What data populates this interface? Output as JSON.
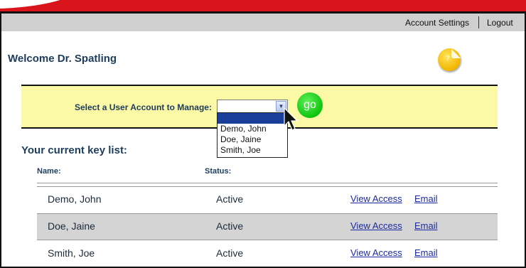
{
  "header": {
    "account_settings": "Account Settings",
    "logout": "Logout"
  },
  "welcome": "Welcome Dr. Spatling",
  "help_icon": "help-sticker-icon",
  "selector": {
    "label": "Select a User Account to Manage:",
    "selected_value": "",
    "go_label": "go",
    "options": [
      "Demo, John",
      "Doe, Jaine",
      "Smith, Joe"
    ]
  },
  "keylist": {
    "title": "Your current key list:",
    "columns": {
      "name": "Name:",
      "status": "Status:"
    },
    "rows": [
      {
        "name": "Demo, John",
        "status": "Active",
        "view": "View Access",
        "email": "Email"
      },
      {
        "name": "Doe, Jaine",
        "status": "Active",
        "view": "View Access",
        "email": "Email"
      },
      {
        "name": "Smith, Joe",
        "status": "Active",
        "view": "View Access",
        "email": "Email"
      }
    ]
  },
  "colors": {
    "banner": "#d9141a",
    "panel": "#fbf9a6",
    "heading": "#1d3c5c",
    "link": "#1b2aa0",
    "go_button": "#10c40d"
  }
}
